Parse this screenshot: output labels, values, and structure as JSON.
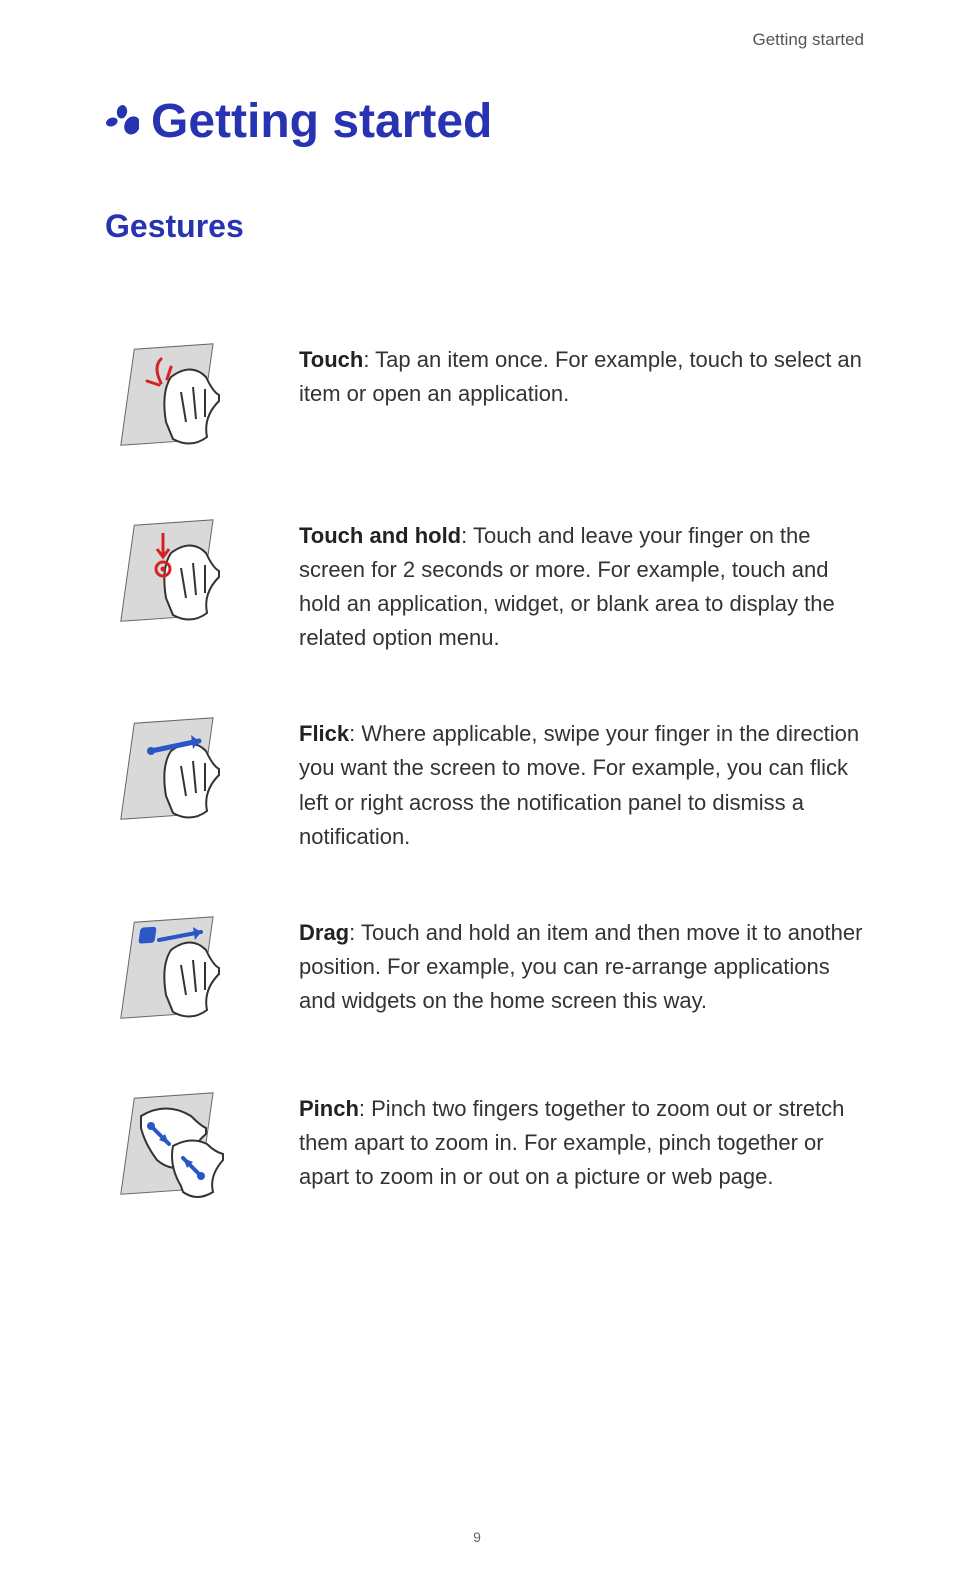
{
  "header": {
    "running_title": "Getting started"
  },
  "main": {
    "title": "Getting started",
    "section": "Gestures"
  },
  "gestures": [
    {
      "term": "Touch",
      "body": ": Tap an item once. For example, touch to select an item or open an application.",
      "icon": "touch-gesture-icon"
    },
    {
      "term": "Touch and hold",
      "body": ": Touch and leave your finger on the screen for 2 seconds or more. For example, touch and hold an application, widget, or blank area to display the related option menu.",
      "icon": "touch-hold-gesture-icon"
    },
    {
      "term": "Flick",
      "body": ": Where applicable, swipe your finger in the direction you want the screen to move. For example, you can flick left or right across the notification panel to dismiss a notification.",
      "icon": "flick-gesture-icon"
    },
    {
      "term": "Drag",
      "body": ": Touch and hold an item and then move it to another position. For example, you can re-arrange applications and widgets on the home screen this way.",
      "icon": "drag-gesture-icon"
    },
    {
      "term": "Pinch",
      "body": ": Pinch two fingers together to zoom out or stretch them apart to zoom in. For example, pinch together or apart to zoom in or out on a picture or web page.",
      "icon": "pinch-gesture-icon"
    }
  ],
  "page_number": "9"
}
